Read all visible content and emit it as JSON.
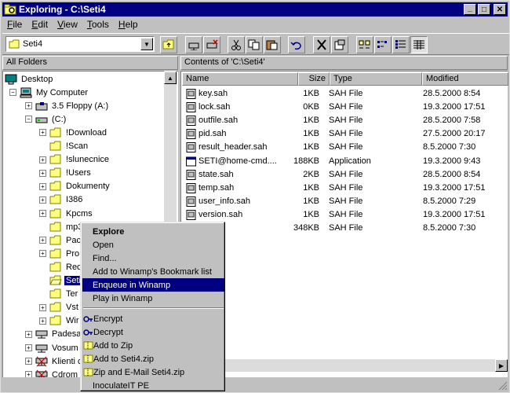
{
  "window": {
    "title": "Exploring - C:\\Seti4",
    "minimize": "_",
    "maximize": "□",
    "close": "✕"
  },
  "menu": [
    "File",
    "Edit",
    "View",
    "Tools",
    "Help"
  ],
  "toolbar": {
    "address_value": "Seti4"
  },
  "panes": {
    "left_title": "All Folders",
    "right_title": "Contents of 'C:\\Seti4'"
  },
  "columns": {
    "name": "Name",
    "size": "Size",
    "type": "Type",
    "modified": "Modified"
  },
  "tree": [
    {
      "label": "Desktop",
      "icon": "desktop-icon",
      "depth": 0,
      "expander": ""
    },
    {
      "label": "My Computer",
      "icon": "computer-icon",
      "depth": 1,
      "expander": "−"
    },
    {
      "label": "3.5 Floppy (A:)",
      "icon": "floppy-icon",
      "depth": 2,
      "expander": "+"
    },
    {
      "label": "(C:)",
      "icon": "drive-icon",
      "depth": 2,
      "expander": "−"
    },
    {
      "label": "!Download",
      "icon": "folder-icon",
      "depth": 3,
      "expander": "+"
    },
    {
      "label": "!Scan",
      "icon": "folder-icon",
      "depth": 3,
      "expander": ""
    },
    {
      "label": "!slunecnice",
      "icon": "folder-icon",
      "depth": 3,
      "expander": "+"
    },
    {
      "label": "!Users",
      "icon": "folder-icon",
      "depth": 3,
      "expander": "+"
    },
    {
      "label": "Dokumenty",
      "icon": "folder-icon",
      "depth": 3,
      "expander": "+"
    },
    {
      "label": "I386",
      "icon": "folder-icon",
      "depth": 3,
      "expander": "+"
    },
    {
      "label": "Kpcms",
      "icon": "folder-icon",
      "depth": 3,
      "expander": "+"
    },
    {
      "label": "mp3",
      "icon": "folder-icon",
      "depth": 3,
      "expander": ""
    },
    {
      "label": "Pac",
      "icon": "folder-icon",
      "depth": 3,
      "expander": "+"
    },
    {
      "label": "Pro",
      "icon": "folder-icon",
      "depth": 3,
      "expander": "+"
    },
    {
      "label": "Rec",
      "icon": "folder-icon",
      "depth": 3,
      "expander": ""
    },
    {
      "label": "Seti",
      "icon": "folder-open-icon",
      "depth": 3,
      "expander": "",
      "selected": true
    },
    {
      "label": "Ter",
      "icon": "folder-icon",
      "depth": 3,
      "expander": ""
    },
    {
      "label": "Vst",
      "icon": "folder-icon",
      "depth": 3,
      "expander": "+"
    },
    {
      "label": "Wir",
      "icon": "folder-icon",
      "depth": 3,
      "expander": "+"
    },
    {
      "label": "Padesa",
      "icon": "network-drive-icon",
      "depth": 2,
      "expander": "+"
    },
    {
      "label": "Vosum",
      "icon": "network-drive-icon",
      "depth": 2,
      "expander": "+"
    },
    {
      "label": "Klienti c",
      "icon": "network-drive-x-icon",
      "depth": 2,
      "expander": "+"
    },
    {
      "label": "Cdrom c",
      "icon": "network-drive-x-icon",
      "depth": 2,
      "expander": "+"
    },
    {
      "label": "Pidizvik",
      "icon": "network-drive-icon",
      "depth": 2,
      "expander": "+"
    }
  ],
  "files": [
    {
      "name": "key.sah",
      "size": "1KB",
      "type": "SAH File",
      "modified": "28.5.2000 8:54",
      "icon": "file-icon"
    },
    {
      "name": "lock.sah",
      "size": "0KB",
      "type": "SAH File",
      "modified": "19.3.2000 17:51",
      "icon": "file-icon"
    },
    {
      "name": "outfile.sah",
      "size": "1KB",
      "type": "SAH File",
      "modified": "28.5.2000 7:58",
      "icon": "file-icon"
    },
    {
      "name": "pid.sah",
      "size": "1KB",
      "type": "SAH File",
      "modified": "27.5.2000 20:17",
      "icon": "file-icon"
    },
    {
      "name": "result_header.sah",
      "size": "1KB",
      "type": "SAH File",
      "modified": "8.5.2000 7:30",
      "icon": "file-icon"
    },
    {
      "name": "SETI@home-cmd....",
      "size": "188KB",
      "type": "Application",
      "modified": "19.3.2000 9:43",
      "icon": "application-icon"
    },
    {
      "name": "state.sah",
      "size": "2KB",
      "type": "SAH File",
      "modified": "28.5.2000 8:54",
      "icon": "file-icon"
    },
    {
      "name": "temp.sah",
      "size": "1KB",
      "type": "SAH File",
      "modified": "19.3.2000 17:51",
      "icon": "file-icon"
    },
    {
      "name": "user_info.sah",
      "size": "1KB",
      "type": "SAH File",
      "modified": "8.5.2000 7:29",
      "icon": "file-icon"
    },
    {
      "name": "version.sah",
      "size": "1KB",
      "type": "SAH File",
      "modified": "19.3.2000 17:51",
      "icon": "file-icon"
    },
    {
      "name": "nit.sah",
      "size": "348KB",
      "type": "SAH File",
      "modified": "8.5.2000 7:30",
      "icon": "file-icon"
    }
  ],
  "context_menu": {
    "items": [
      {
        "label": "Explore",
        "bold": true
      },
      {
        "label": "Open"
      },
      {
        "label": "Find..."
      },
      {
        "label": "Add to Winamp's Bookmark list"
      },
      {
        "label": "Enqueue in Winamp",
        "highlighted": true
      },
      {
        "label": "Play in Winamp"
      },
      {
        "separator": true
      },
      {
        "label": "Encrypt",
        "icon": "encrypt-icon"
      },
      {
        "label": "Decrypt",
        "icon": "decrypt-icon"
      },
      {
        "label": "Add to Zip",
        "icon": "zip-icon"
      },
      {
        "label": "Add to Seti4.zip",
        "icon": "zip-icon"
      },
      {
        "label": "Zip and E-Mail Seti4.zip",
        "icon": "zip-icon"
      },
      {
        "label": "InoculateIT PE"
      }
    ]
  },
  "colors": {
    "titlebar": "#000080",
    "selection": "#000080",
    "face": "#c0c0c0"
  }
}
